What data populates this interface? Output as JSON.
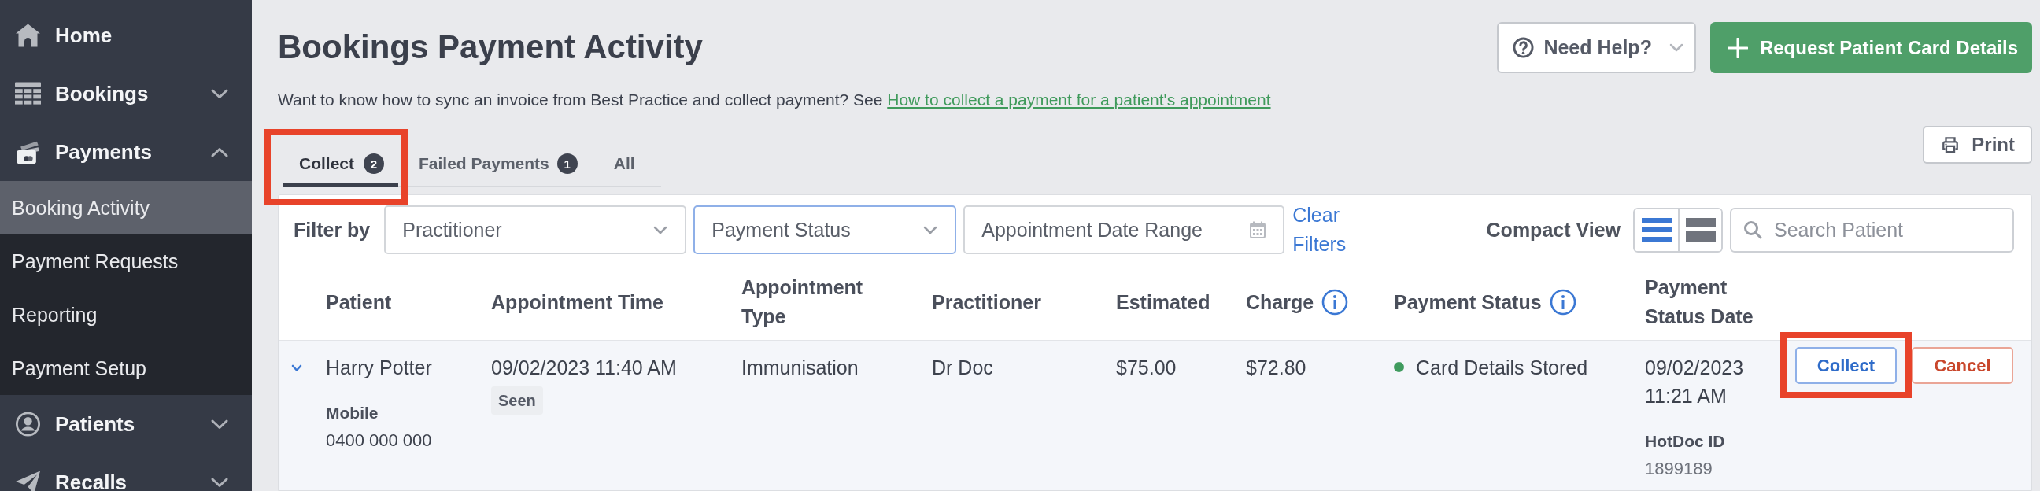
{
  "sidebar": {
    "items": [
      {
        "label": "Home",
        "kind": "link"
      },
      {
        "label": "Bookings",
        "kind": "group",
        "expanded": false
      },
      {
        "label": "Payments",
        "kind": "group",
        "expanded": true,
        "children": [
          {
            "label": "Booking Activity",
            "selected": true
          },
          {
            "label": "Payment Requests",
            "selected": false
          },
          {
            "label": "Reporting",
            "selected": false
          },
          {
            "label": "Payment Setup",
            "selected": false
          }
        ]
      },
      {
        "label": "Patients",
        "kind": "group",
        "expanded": false
      },
      {
        "label": "Recalls",
        "kind": "group",
        "expanded": false
      }
    ]
  },
  "page": {
    "title": "Bookings Payment Activity",
    "help_button": {
      "label": "Need Help?"
    },
    "request_button": {
      "label": "Request Patient Card Details"
    },
    "intro": {
      "text": "Want to know how to sync an invoice from Best Practice and collect payment? See",
      "link": "How to collect a payment for a patient's appointment"
    },
    "print_button": {
      "label": "Print"
    }
  },
  "tabs": [
    {
      "label": "Collect",
      "count": "2",
      "selected": true,
      "highlighted": true
    },
    {
      "label": "Failed Payments",
      "count": "1",
      "selected": false,
      "highlighted": false
    },
    {
      "label": "All",
      "selected": false,
      "highlighted": false
    }
  ],
  "filters": {
    "label": "Filter by",
    "fields": [
      {
        "kind": "select",
        "placeholder": "Practitioner",
        "focused": false
      },
      {
        "kind": "select",
        "placeholder": "Payment Status",
        "focused": true
      },
      {
        "kind": "date",
        "placeholder": "Appointment Date Range",
        "focused": false
      }
    ],
    "clear": "Clear Filters",
    "compact_view": {
      "label": "Compact View",
      "options": [
        {
          "kind": "compact",
          "selected": true
        },
        {
          "kind": "comfortable",
          "selected": false
        }
      ]
    },
    "search": {
      "placeholder": "Search Patient"
    }
  },
  "table": {
    "columns": [
      {
        "label": "Patient",
        "info": false
      },
      {
        "label": "Appointment Time",
        "info": false
      },
      {
        "label": "Appointment Type",
        "info": false
      },
      {
        "label": "Practitioner",
        "info": false
      },
      {
        "label": "Estimated",
        "info": false
      },
      {
        "label": "Charge",
        "info": true
      },
      {
        "label": "Payment Status",
        "info": true
      },
      {
        "label": "Payment Status Date",
        "info": false
      }
    ],
    "rows": [
      {
        "expanded": true,
        "patient": "Harry Potter",
        "phone_label": "Mobile",
        "phone": "0400 000 000",
        "appointment_time": "09/02/2023 11:40 AM",
        "attendance": "Seen",
        "appointment_type": "Immunisation",
        "practitioner": "Dr Doc",
        "estimated": "$75.00",
        "charge": "$72.80",
        "payment_status": {
          "label": "Card Details Stored",
          "color": "#3f9b5e"
        },
        "status_date": "09/02/2023 11:21 AM",
        "reference_label": "HotDoc ID",
        "reference": "1899189",
        "actions": [
          {
            "kind": "primary",
            "label": "Collect",
            "highlighted": true
          },
          {
            "kind": "danger",
            "label": "Cancel",
            "highlighted": false
          }
        ]
      }
    ]
  }
}
